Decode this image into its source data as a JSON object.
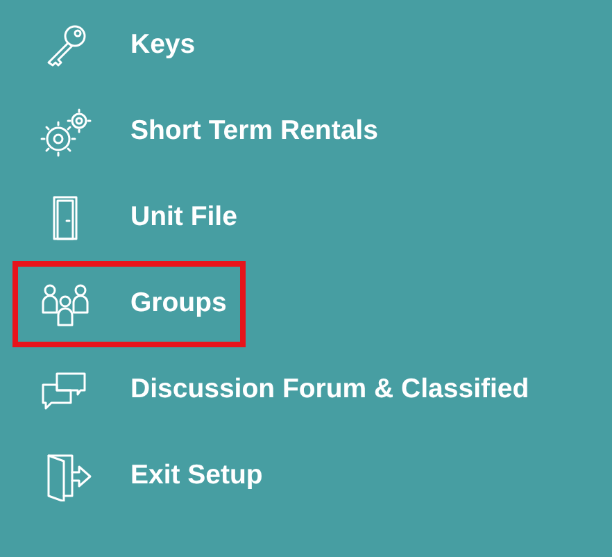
{
  "menu": {
    "items": [
      {
        "label": "Keys",
        "highlighted": false
      },
      {
        "label": "Short Term Rentals",
        "highlighted": false
      },
      {
        "label": "Unit File",
        "highlighted": false
      },
      {
        "label": "Groups",
        "highlighted": true
      },
      {
        "label": "Discussion Forum & Classified",
        "highlighted": false
      },
      {
        "label": "Exit Setup",
        "highlighted": false
      }
    ]
  }
}
